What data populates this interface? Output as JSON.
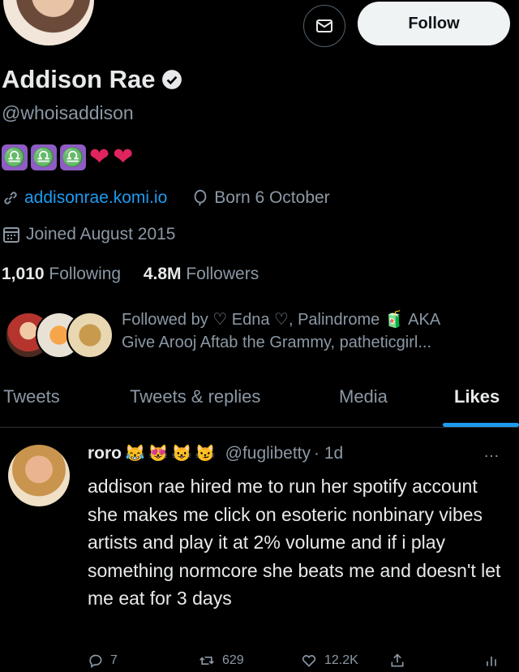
{
  "header": {
    "follow_label": "Follow"
  },
  "profile": {
    "name": "Addison Rae",
    "handle": "@whoisaddison",
    "bio_emojis": [
      "♎",
      "♎",
      "♎",
      "❤",
      "❤"
    ],
    "website": "addisonrae.komi.io",
    "birthday": "Born 6 October",
    "joined": "Joined August 2015",
    "following_count": "1,010",
    "following_label": "Following",
    "followers_count": "4.8M",
    "followers_label": "Followers",
    "followed_by_line1": "Followed by ♡ Edna ♡, Palindrome 🧃 AKA",
    "followed_by_line2": "Give Arooj Aftab the Grammy, patheticgirl..."
  },
  "tabs": [
    {
      "label": "Tweets"
    },
    {
      "label": "Tweets & replies"
    },
    {
      "label": "Media"
    },
    {
      "label": "Likes"
    }
  ],
  "tweet": {
    "author": "roro",
    "emojis": [
      "😹",
      "😻",
      "😺",
      "😼"
    ],
    "handle": "@fuglibetty",
    "time": "· 1d",
    "more": "…",
    "text": "addison rae hired me to run her spotify account she makes me click on esoteric nonbinary vibes artists and play it at 2% volume and if i play something normcore she beats me and doesn't let me eat for 3 days",
    "replies": "7",
    "retweets": "629",
    "likes": "12.2K"
  },
  "colors": {
    "accent": "#1d9bf0",
    "background": "#000000",
    "muted": "#8b98a5"
  }
}
